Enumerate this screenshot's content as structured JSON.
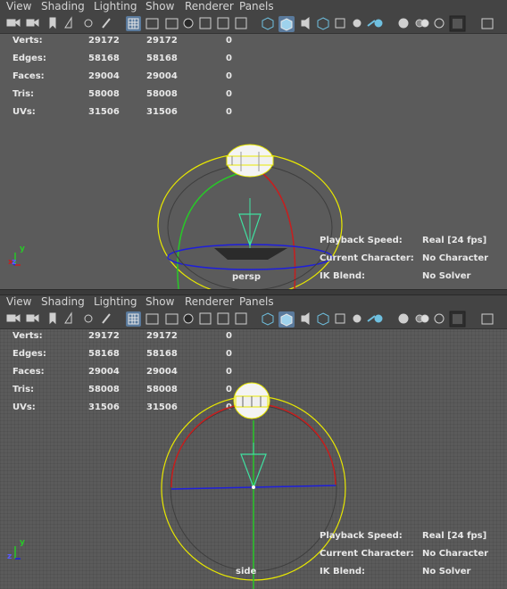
{
  "menus": [
    "View",
    "Shading",
    "Lighting",
    "Show",
    "Renderer",
    "Panels"
  ],
  "stats": [
    {
      "label": "Verts:",
      "a": "29172",
      "b": "29172",
      "c": "0"
    },
    {
      "label": "Edges:",
      "a": "58168",
      "b": "58168",
      "c": "0"
    },
    {
      "label": "Faces:",
      "a": "29004",
      "b": "29004",
      "c": "0"
    },
    {
      "label": "Tris:",
      "a": "58008",
      "b": "58008",
      "c": "0"
    },
    {
      "label": "UVs:",
      "a": "31506",
      "b": "31506",
      "c": "0"
    }
  ],
  "hud": {
    "playback_label": "Playback Speed:",
    "playback_value": "Real [24 fps]",
    "character_label": "Current Character:",
    "character_value": "No Character",
    "ik_label": "IK Blend:",
    "ik_value": "No Solver"
  },
  "top_view_label": "persp",
  "bottom_view_label": "side",
  "axis_labels": {
    "y": "y",
    "x": "x",
    "z": "z"
  },
  "colors": {
    "viewport_bg": "#5b5b5b",
    "menubar_bg": "#444444",
    "active_button": "#5a7a9c",
    "circle_yellow": "#e8e800",
    "circle_red": "#c81e1e",
    "circle_blue": "#1e1edc",
    "circle_green": "#28c828",
    "light_cyan": "#40e0a0"
  },
  "toolbar_icons": [
    "camera-icon",
    "camera-attr-icon",
    "bookmark-icon",
    "image-plane-icon",
    "2d-pan-icon",
    "grease-pencil-icon",
    "grid-icon",
    "film-gate-icon",
    "resolution-gate-icon",
    "gate-mask-icon",
    "field-chart-icon",
    "safe-action-icon",
    "safe-title-icon",
    "wireframe-icon",
    "smooth-shade-icon",
    "wireframe-on-shaded-icon",
    "textured-icon",
    "use-all-lights-icon",
    "shadows-icon",
    "screen-space-ao-icon",
    "motion-blur-icon",
    "multisample-aa-icon",
    "depth-of-field-icon",
    "isolate-select-icon",
    "xray-icon",
    "xray-joints-icon",
    "xray-active-icon",
    "panel-layout-icon"
  ]
}
